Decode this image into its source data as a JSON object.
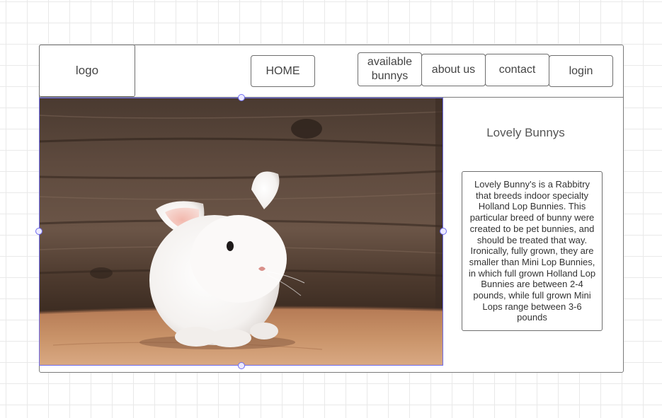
{
  "header": {
    "logo_label": "logo",
    "nav": {
      "home": "HOME",
      "available_line1": "available",
      "available_line2": "bunnys",
      "about": "about us",
      "contact": "contact",
      "login": "login"
    }
  },
  "hero_image": {
    "subject": "white bunny on wooden floor"
  },
  "side_panel": {
    "title": "Lovely Bunnys",
    "description": "Lovely Bunny's is a Rabbitry that breeds indoor specialty Holland Lop Bunnies. This particular breed of bunny were created to be pet bunnies, and should be treated that way. Ironically, fully grown, they are smaller than Mini Lop Bunnies, in which full grown Holland Lop Bunnies are between 2-4 pounds, while full grown Mini Lops range between 3-6 pounds"
  },
  "colors": {
    "selection": "#6f6cf0",
    "outline": "#6e6e6e",
    "grid": "#e9e9e9"
  }
}
